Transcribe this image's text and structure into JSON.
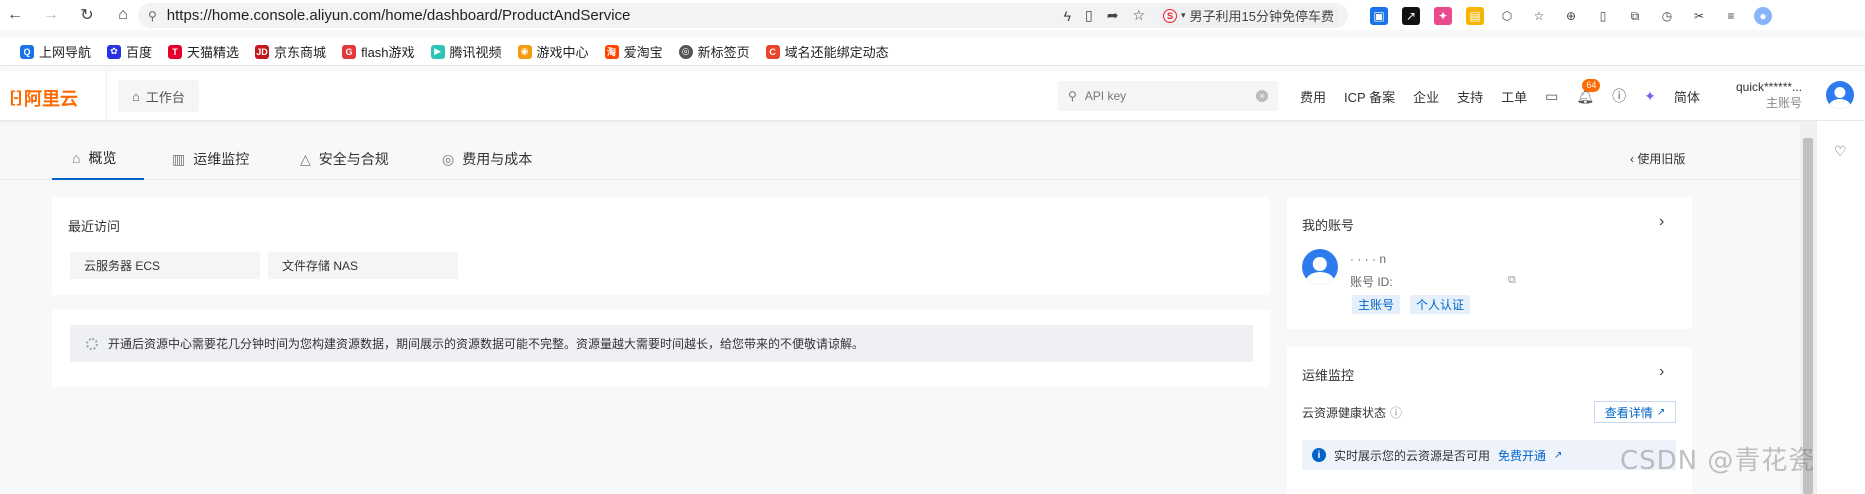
{
  "browser": {
    "url": "https://home.console.aliyun.com/home/dashboard/ProductAndService",
    "hot_search": "男子利用15分钟免停车费",
    "bookmarks": [
      {
        "label": "上网导航",
        "icon": "blue-q-icon",
        "color": "#1a73e8"
      },
      {
        "label": "百度",
        "icon": "baidu-paw-icon",
        "color": "#2932e1"
      },
      {
        "label": "天猫精选",
        "icon": "tmall-icon",
        "color": "#e4002b"
      },
      {
        "label": "京东商城",
        "icon": "jd-icon",
        "color": "#c4161c"
      },
      {
        "label": "flash游戏",
        "icon": "flash-game-icon",
        "color": "#e4393c"
      },
      {
        "label": "腾讯视频",
        "icon": "tencent-video-icon",
        "color": "#2ec4b6"
      },
      {
        "label": "游戏中心",
        "icon": "game-center-icon",
        "color": "#f39c12"
      },
      {
        "label": "爱淘宝",
        "icon": "taobao-icon",
        "color": "#ff4400"
      },
      {
        "label": "新标签页",
        "icon": "new-tab-icon",
        "color": "#555555"
      },
      {
        "label": "域名还能绑定动态",
        "icon": "c-logo-icon",
        "color": "#e8452c"
      }
    ]
  },
  "topbar": {
    "logo": "阿里云",
    "workbench": "工作台",
    "search_value": "API key",
    "nav": [
      "费用",
      "ICP 备案",
      "企业",
      "支持",
      "工单"
    ],
    "notification_count": "64",
    "language": "简体",
    "user_name": "quick******...",
    "user_role": "主账号"
  },
  "tabs": [
    {
      "label": "概览",
      "icon": "home-icon"
    },
    {
      "label": "运维监控",
      "icon": "bar-chart-icon"
    },
    {
      "label": "安全与合规",
      "icon": "warning-icon"
    },
    {
      "label": "费用与成本",
      "icon": "cost-icon"
    }
  ],
  "old_version": "使用旧版",
  "recent": {
    "title": "最近访问",
    "items": [
      "云服务器 ECS",
      "文件存储 NAS"
    ]
  },
  "notice": "开通后资源中心需要花几分钟时间为您构建资源数据，期间展示的资源数据可能不完整。资源量越大需要时间越长，给您带来的不便敬请谅解。",
  "account": {
    "title": "我的账号",
    "name_masked": "·    ·      ·   · n",
    "id_label": "账号 ID:",
    "tags": [
      "主账号",
      "个人认证"
    ]
  },
  "ops": {
    "title": "运维监控",
    "health_label": "云资源健康状态",
    "detail_button": "查看详情",
    "info_text": "实时展示您的云资源是否可用",
    "info_link": "免费开通"
  },
  "watermark": "CSDN @青花瓷"
}
